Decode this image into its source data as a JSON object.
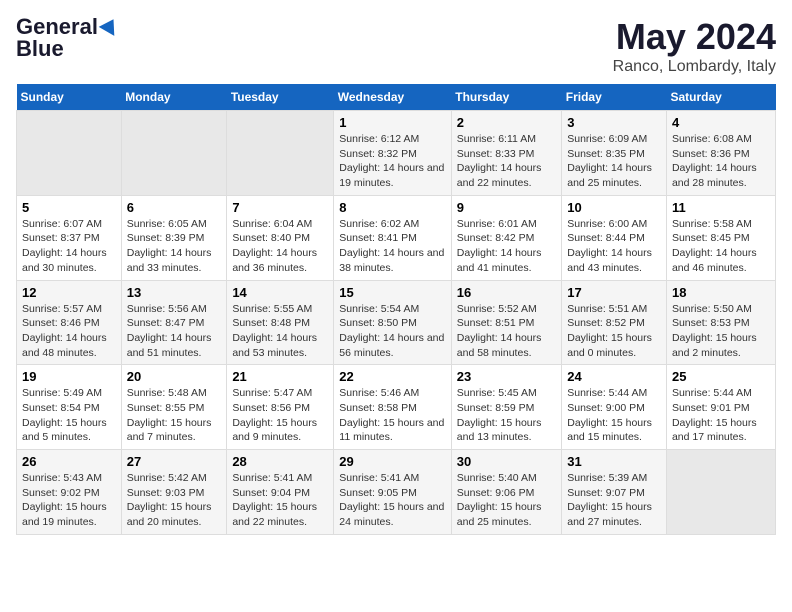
{
  "header": {
    "logo_line1": "General",
    "logo_line2": "Blue",
    "title": "May 2024",
    "subtitle": "Ranco, Lombardy, Italy"
  },
  "weekdays": [
    "Sunday",
    "Monday",
    "Tuesday",
    "Wednesday",
    "Thursday",
    "Friday",
    "Saturday"
  ],
  "weeks": [
    [
      {
        "day": "",
        "empty": true
      },
      {
        "day": "",
        "empty": true
      },
      {
        "day": "",
        "empty": true
      },
      {
        "day": "1",
        "sunrise": "6:12 AM",
        "sunset": "8:32 PM",
        "daylight": "14 hours and 19 minutes."
      },
      {
        "day": "2",
        "sunrise": "6:11 AM",
        "sunset": "8:33 PM",
        "daylight": "14 hours and 22 minutes."
      },
      {
        "day": "3",
        "sunrise": "6:09 AM",
        "sunset": "8:35 PM",
        "daylight": "14 hours and 25 minutes."
      },
      {
        "day": "4",
        "sunrise": "6:08 AM",
        "sunset": "8:36 PM",
        "daylight": "14 hours and 28 minutes."
      }
    ],
    [
      {
        "day": "5",
        "sunrise": "6:07 AM",
        "sunset": "8:37 PM",
        "daylight": "14 hours and 30 minutes."
      },
      {
        "day": "6",
        "sunrise": "6:05 AM",
        "sunset": "8:39 PM",
        "daylight": "14 hours and 33 minutes."
      },
      {
        "day": "7",
        "sunrise": "6:04 AM",
        "sunset": "8:40 PM",
        "daylight": "14 hours and 36 minutes."
      },
      {
        "day": "8",
        "sunrise": "6:02 AM",
        "sunset": "8:41 PM",
        "daylight": "14 hours and 38 minutes."
      },
      {
        "day": "9",
        "sunrise": "6:01 AM",
        "sunset": "8:42 PM",
        "daylight": "14 hours and 41 minutes."
      },
      {
        "day": "10",
        "sunrise": "6:00 AM",
        "sunset": "8:44 PM",
        "daylight": "14 hours and 43 minutes."
      },
      {
        "day": "11",
        "sunrise": "5:58 AM",
        "sunset": "8:45 PM",
        "daylight": "14 hours and 46 minutes."
      }
    ],
    [
      {
        "day": "12",
        "sunrise": "5:57 AM",
        "sunset": "8:46 PM",
        "daylight": "14 hours and 48 minutes."
      },
      {
        "day": "13",
        "sunrise": "5:56 AM",
        "sunset": "8:47 PM",
        "daylight": "14 hours and 51 minutes."
      },
      {
        "day": "14",
        "sunrise": "5:55 AM",
        "sunset": "8:48 PM",
        "daylight": "14 hours and 53 minutes."
      },
      {
        "day": "15",
        "sunrise": "5:54 AM",
        "sunset": "8:50 PM",
        "daylight": "14 hours and 56 minutes."
      },
      {
        "day": "16",
        "sunrise": "5:52 AM",
        "sunset": "8:51 PM",
        "daylight": "14 hours and 58 minutes."
      },
      {
        "day": "17",
        "sunrise": "5:51 AM",
        "sunset": "8:52 PM",
        "daylight": "15 hours and 0 minutes."
      },
      {
        "day": "18",
        "sunrise": "5:50 AM",
        "sunset": "8:53 PM",
        "daylight": "15 hours and 2 minutes."
      }
    ],
    [
      {
        "day": "19",
        "sunrise": "5:49 AM",
        "sunset": "8:54 PM",
        "daylight": "15 hours and 5 minutes."
      },
      {
        "day": "20",
        "sunrise": "5:48 AM",
        "sunset": "8:55 PM",
        "daylight": "15 hours and 7 minutes."
      },
      {
        "day": "21",
        "sunrise": "5:47 AM",
        "sunset": "8:56 PM",
        "daylight": "15 hours and 9 minutes."
      },
      {
        "day": "22",
        "sunrise": "5:46 AM",
        "sunset": "8:58 PM",
        "daylight": "15 hours and 11 minutes."
      },
      {
        "day": "23",
        "sunrise": "5:45 AM",
        "sunset": "8:59 PM",
        "daylight": "15 hours and 13 minutes."
      },
      {
        "day": "24",
        "sunrise": "5:44 AM",
        "sunset": "9:00 PM",
        "daylight": "15 hours and 15 minutes."
      },
      {
        "day": "25",
        "sunrise": "5:44 AM",
        "sunset": "9:01 PM",
        "daylight": "15 hours and 17 minutes."
      }
    ],
    [
      {
        "day": "26",
        "sunrise": "5:43 AM",
        "sunset": "9:02 PM",
        "daylight": "15 hours and 19 minutes."
      },
      {
        "day": "27",
        "sunrise": "5:42 AM",
        "sunset": "9:03 PM",
        "daylight": "15 hours and 20 minutes."
      },
      {
        "day": "28",
        "sunrise": "5:41 AM",
        "sunset": "9:04 PM",
        "daylight": "15 hours and 22 minutes."
      },
      {
        "day": "29",
        "sunrise": "5:41 AM",
        "sunset": "9:05 PM",
        "daylight": "15 hours and 24 minutes."
      },
      {
        "day": "30",
        "sunrise": "5:40 AM",
        "sunset": "9:06 PM",
        "daylight": "15 hours and 25 minutes."
      },
      {
        "day": "31",
        "sunrise": "5:39 AM",
        "sunset": "9:07 PM",
        "daylight": "15 hours and 27 minutes."
      },
      {
        "day": "",
        "empty": true
      }
    ]
  ]
}
